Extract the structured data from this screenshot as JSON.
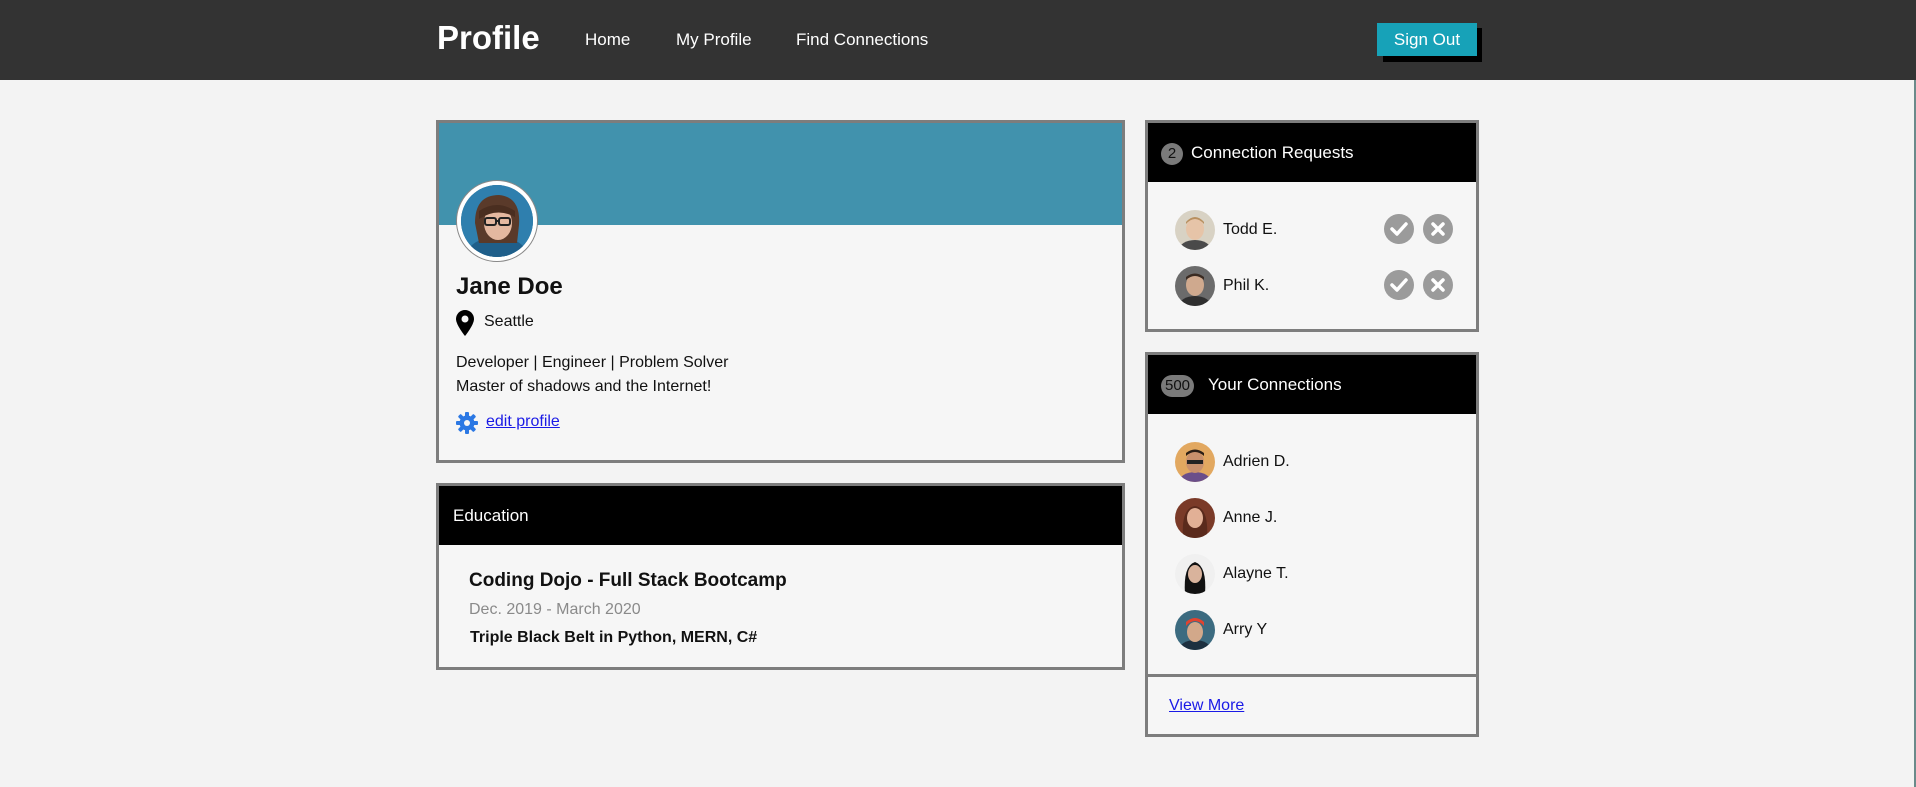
{
  "header": {
    "brand": "Profile",
    "nav": [
      "Home",
      "My Profile",
      "Find Connections"
    ],
    "sign_out": "Sign Out"
  },
  "profile": {
    "name": "Jane Doe",
    "location": "Seattle",
    "bio_line1": "Developer | Engineer | Problem Solver",
    "bio_line2": "Master of shadows and the Internet!",
    "edit_label": "edit profile"
  },
  "education": {
    "heading": "Education",
    "school": "Coding Dojo - Full Stack Bootcamp",
    "dates": "Dec. 2019 - March 2020",
    "description": "Triple Black Belt in Python, MERN, C#"
  },
  "requests": {
    "count": "2",
    "title": "Connection Requests",
    "people": [
      "Todd E.",
      "Phil K."
    ]
  },
  "connections": {
    "count": "500",
    "title": "Your Connections",
    "people": [
      "Adrien D.",
      "Anne J.",
      "Alayne T.",
      "Arry Y"
    ],
    "view_more": "View More"
  },
  "colors": {
    "topbar": "#333333",
    "accent_button": "#17a2b8",
    "banner": "#4192ad",
    "link": "#1a1ae6"
  },
  "icons": [
    "location-pin-icon",
    "gear-icon",
    "check-icon",
    "close-icon"
  ]
}
